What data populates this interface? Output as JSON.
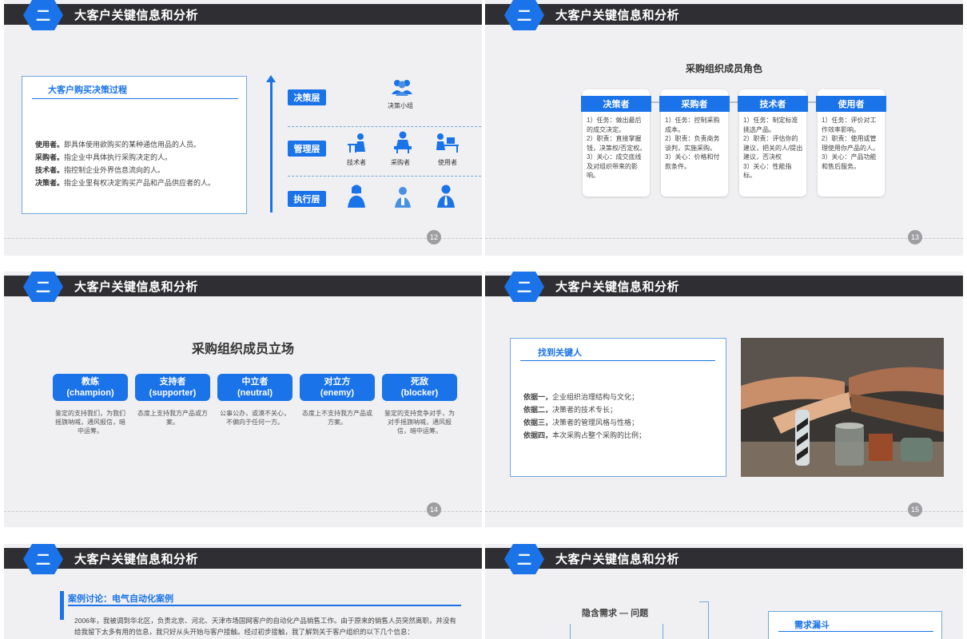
{
  "header_title": "大客户关键信息和分析",
  "section_number": "二",
  "slide12": {
    "page": "12",
    "box_title": "大客户购买决策过程",
    "definitions": [
      {
        "term": "使用者。",
        "text": "即具体使用欲购买的某种通信用品的人员。"
      },
      {
        "term": "采购者。",
        "text": "指企业中具体执行采购决定的人。"
      },
      {
        "term": "技术者。",
        "text": "指控制企业外界信息流向的人。"
      },
      {
        "term": "决策者。",
        "text": "指企业里有权决定购买产品和产品供应者的人。"
      }
    ],
    "levels": [
      "决策层",
      "管理层",
      "执行层"
    ],
    "decision_group": "决策小组",
    "roles": [
      "技术者",
      "采购者",
      "使用者"
    ]
  },
  "slide13": {
    "page": "13",
    "title": "采购组织成员角色",
    "roles": [
      {
        "name": "决策者",
        "desc": "1）任务：做出最后的成交决定。\n2）职责：直接掌握钱，决策权/否定权。\n3）关心：成交底线及对组织带来的影响。"
      },
      {
        "name": "采购者",
        "desc": "1）任务：控制采购成本。\n2）职责：负责商务谈判，实施采购。\n3）关心：价格和付款条件。"
      },
      {
        "name": "技术者",
        "desc": "1）任务：制定标准挑选产品。\n2）职责：评估你的建议，把关的人/提出建议，否决权\n3）关心：性能指标。"
      },
      {
        "name": "使用者",
        "desc": "1）任务：评价对工作效率影响。\n2）职责：使用或管理使用你产品的人。\n3）关心：产品功能和售后服务。"
      }
    ]
  },
  "slide14": {
    "page": "14",
    "title": "采购组织成员立场",
    "stances": [
      {
        "cn": "教练",
        "en": "(champion)",
        "desc": "鉴定的支持我们，为我们摇旗呐喊，通风报信，暗中运筹。"
      },
      {
        "cn": "支持者",
        "en": "(supporter)",
        "desc": "态度上支持我方产品或方案。"
      },
      {
        "cn": "中立者",
        "en": "(neutral)",
        "desc": "公事公办，或漠不关心，不偏向于任何一方。"
      },
      {
        "cn": "对立方",
        "en": "(enemy)",
        "desc": "态度上不支持我方产品或方案。"
      },
      {
        "cn": "死敌",
        "en": "(blocker)",
        "desc": "鉴定的支持竞争对手，为对手摇旗呐喊，通风报信，暗中运筹。"
      }
    ]
  },
  "slide15": {
    "page": "15",
    "box_title": "找到关键人",
    "basis": [
      {
        "term": "依据一，",
        "text": "企业组织治理结构与文化；"
      },
      {
        "term": "依据二，",
        "text": "决策者的技术专长；"
      },
      {
        "term": "依据三，",
        "text": "决策者的管理风格与性格；"
      },
      {
        "term": "依据四，",
        "text": "本次采购占整个采购的比例；"
      }
    ]
  },
  "slide16": {
    "title": "案例讨论：电气自动化案例",
    "text": "2006年，我被调到华北区，负责北京、河北、天津市场国网客户的自动化产品销售工作。由于原来的销售人员突然离职，并没有给我留下太多有用的信息，我只好从头开始与客户接触。经过初步接触，我了解到关于客户组织的以下几个信息："
  },
  "slide17": {
    "hidden_need": "隐含需求 — 问题",
    "funnel_title": "需求漏斗"
  }
}
